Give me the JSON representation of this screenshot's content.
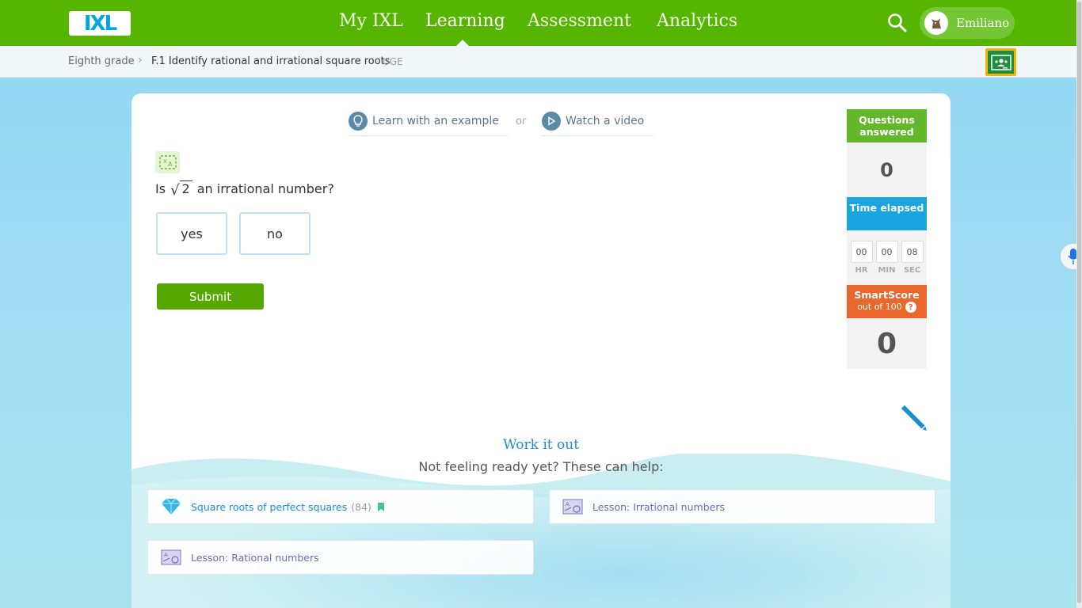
{
  "header": {
    "logo_text": "IXL",
    "nav": [
      "My IXL",
      "Learning",
      "Assessment",
      "Analytics"
    ],
    "active_nav": "Learning",
    "user_name": "Emiliano",
    "search_icon": "search-icon",
    "brand_color": "#56b500"
  },
  "breadcrumb": {
    "grade": "Eighth grade",
    "skill": "F.1 Identify rational and irrational square roots",
    "code": "UGE"
  },
  "help": {
    "example_label": "Learn with an example",
    "or_label": "or",
    "video_label": "Watch a video"
  },
  "question": {
    "prefix": "Is",
    "radicand": "2",
    "suffix": "an irrational number?",
    "choices": [
      "yes",
      "no"
    ],
    "submit_label": "Submit"
  },
  "stats": {
    "questions_label": "Questions answered",
    "questions_value": "0",
    "time_label": "Time elapsed",
    "time": {
      "hr": "00",
      "min": "00",
      "sec": "08"
    },
    "time_units": {
      "hr": "HR",
      "min": "MIN",
      "sec": "SEC"
    },
    "smartscore_label": "SmartScore",
    "smartscore_sub": "out of 100",
    "smartscore_help": "?",
    "smartscore_value": "0"
  },
  "work_it_out": {
    "title": "Work it out",
    "subtitle": "Not feeling ready yet? These can help:",
    "resources": [
      {
        "label": "Square roots of perfect squares",
        "count": "(84)",
        "icon": "diamond-icon"
      },
      {
        "label": "Lesson: Irrational numbers",
        "icon": "lesson-icon"
      },
      {
        "label": "Lesson: Rational numbers",
        "icon": "lesson-icon"
      }
    ]
  }
}
